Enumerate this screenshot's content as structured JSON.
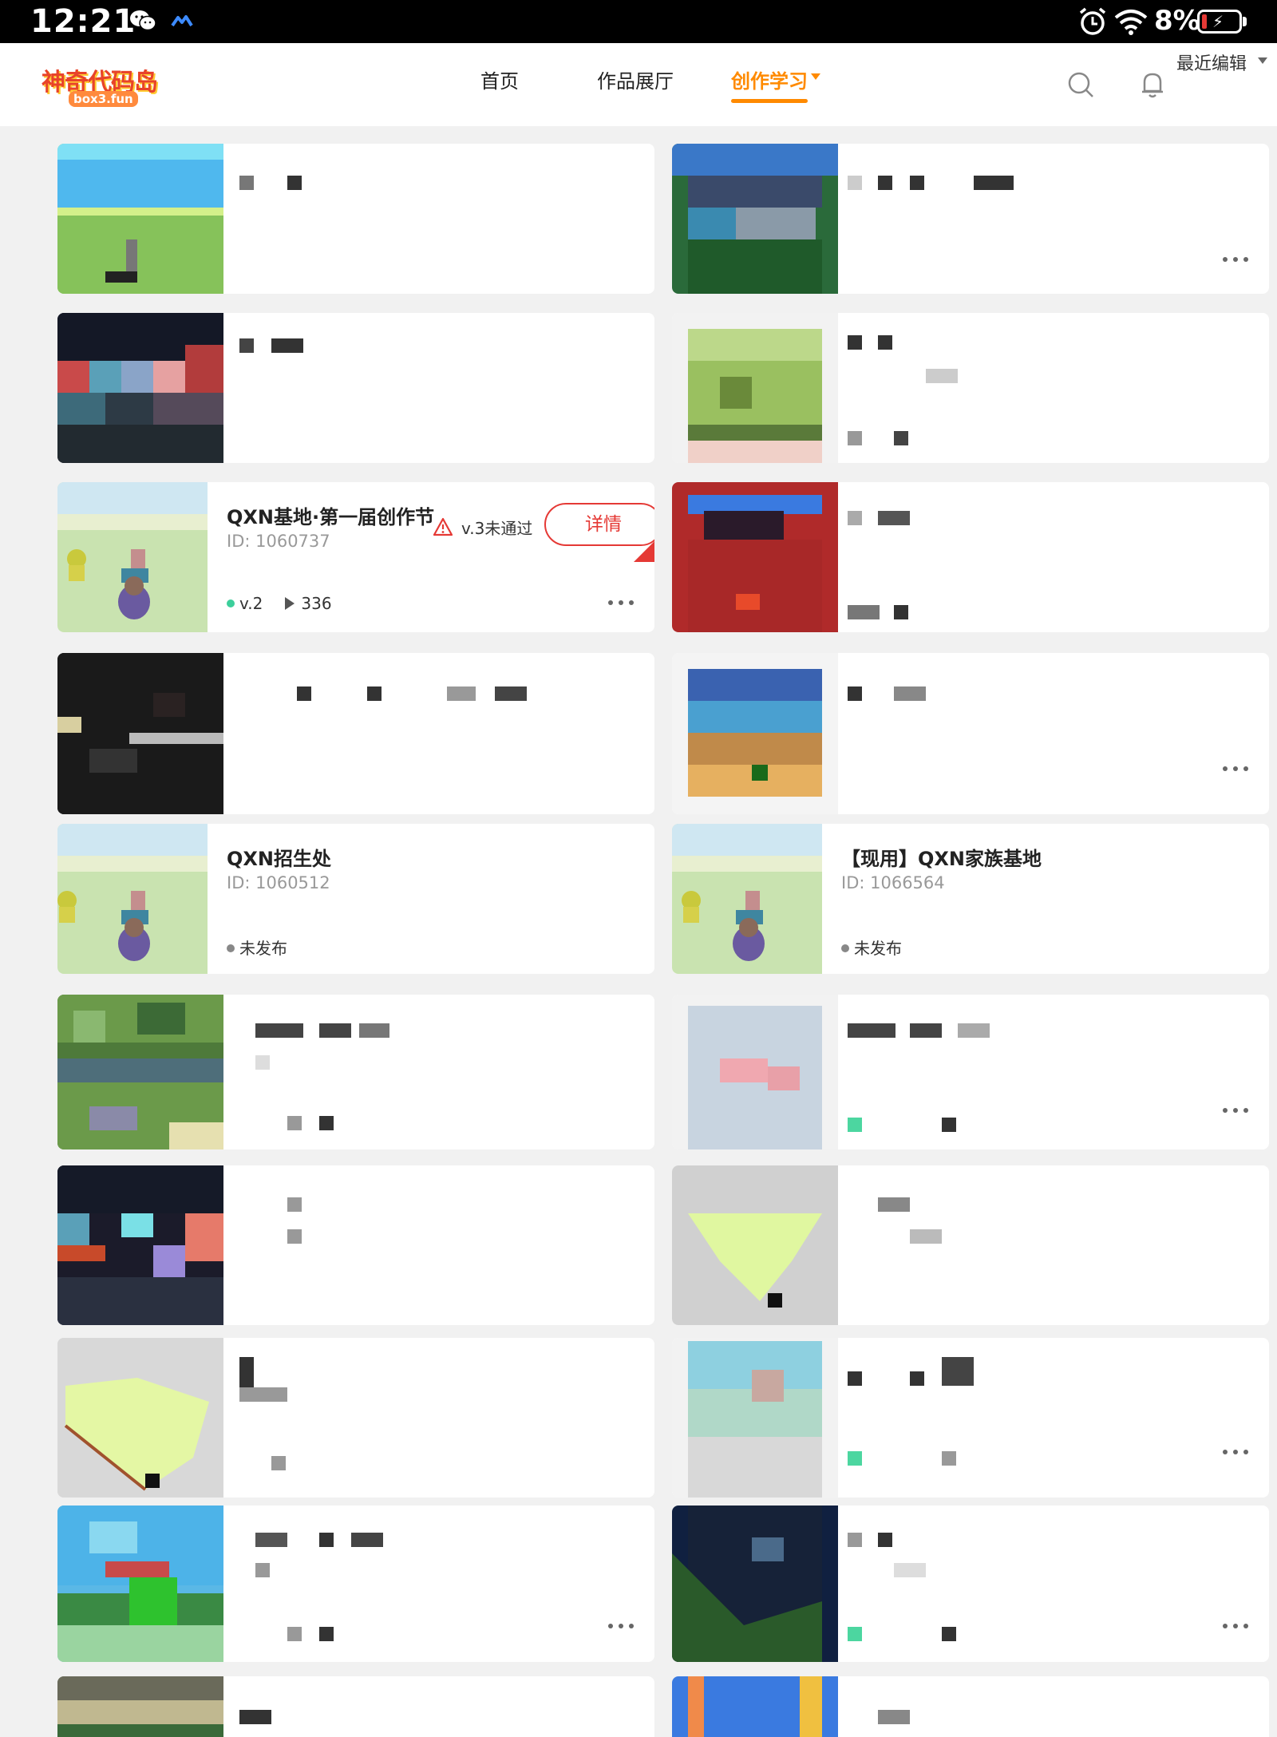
{
  "status_bar": {
    "time": "12:21",
    "battery_percent": "8%",
    "icons": [
      "wechat-icon",
      "cloud-sync-icon",
      "alarm-icon",
      "wifi-icon",
      "battery-charging-icon"
    ]
  },
  "header": {
    "logo_text": "神奇代码岛",
    "logo_subtext": "box3.fun",
    "nav": {
      "home": "首页",
      "gallery": "作品展厅",
      "learn": "创作学习"
    },
    "active_nav": "learn",
    "sort_label": "最近编辑",
    "icons": [
      "search-icon",
      "bell-icon"
    ],
    "accent_color": "#ff8a00"
  },
  "cards": {
    "contest": {
      "title": "QXN基地·第一届创作节",
      "id_text": "ID: 1060737",
      "warning_text": "v.3未通过",
      "detail_button": "详情",
      "version": "v.2",
      "plays": "336",
      "version_dot_color": "#3ccf9b"
    },
    "recruit": {
      "title": "QXN招生处",
      "id_text": "ID: 1060512",
      "status": "未发布"
    },
    "family": {
      "title": "【现用】QXN家族基地",
      "id_text": "ID: 1066564",
      "status": "未发布"
    }
  },
  "colors": {
    "danger": "#e53935",
    "page_bg": "#f1f1f1",
    "card_bg": "#ffffff"
  }
}
